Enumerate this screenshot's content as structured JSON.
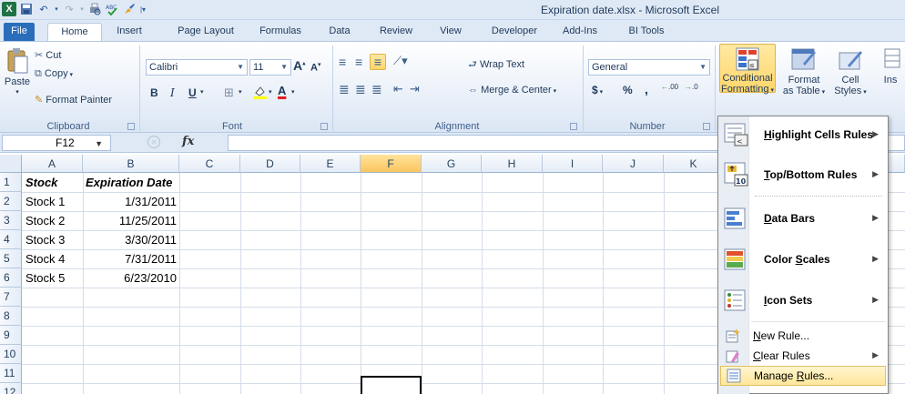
{
  "window": {
    "title": "Expiration date.xlsx - Microsoft Excel"
  },
  "qat": {
    "excel_icon": "X"
  },
  "tabs": [
    {
      "label": "File"
    },
    {
      "label": "Home"
    },
    {
      "label": "Insert"
    },
    {
      "label": "Page Layout"
    },
    {
      "label": "Formulas"
    },
    {
      "label": "Data"
    },
    {
      "label": "Review"
    },
    {
      "label": "View"
    },
    {
      "label": "Developer"
    },
    {
      "label": "Add-Ins"
    },
    {
      "label": "BI Tools"
    }
  ],
  "ribbon": {
    "clipboard": {
      "paste": "Paste",
      "cut": "Cut",
      "copy": "Copy",
      "format_painter": "Format Painter",
      "label": "Clipboard"
    },
    "font": {
      "name": "Calibri",
      "size": "11",
      "bold": "B",
      "italic": "I",
      "underline": "U",
      "label": "Font",
      "grow": "A",
      "shrink": "A",
      "color_a": "A"
    },
    "alignment": {
      "wrap_text": "Wrap Text",
      "merge_center": "Merge & Center",
      "label": "Alignment"
    },
    "number": {
      "format": "General",
      "currency": "$",
      "percent": "%",
      "comma": ",",
      "inc_dec": ".00",
      "dec_dec": ".0",
      "label": "Number"
    },
    "styles": {
      "conditional_1": "Conditional",
      "conditional_2": "Formatting",
      "format_table_1": "Format",
      "format_table_2": "as Table",
      "cell_styles_1": "Cell",
      "cell_styles_2": "Styles",
      "insert": "Ins"
    }
  },
  "formula_bar": {
    "name_box": "F12",
    "fx": "fx",
    "cancel": "×",
    "value": ""
  },
  "columns": [
    "A",
    "B",
    "C",
    "D",
    "E",
    "F",
    "G",
    "H",
    "I",
    "J",
    "K"
  ],
  "rows": [
    "1",
    "2",
    "3",
    "4",
    "5",
    "6",
    "7",
    "8",
    "9",
    "10",
    "11",
    "12"
  ],
  "sheet": {
    "header": {
      "stock": "Stock",
      "expiration": "Expiration Date"
    },
    "data": [
      {
        "stock": "Stock 1",
        "date": "1/31/2011"
      },
      {
        "stock": "Stock 2",
        "date": "11/25/2011"
      },
      {
        "stock": "Stock 3",
        "date": "3/30/2011"
      },
      {
        "stock": "Stock 4",
        "date": "7/31/2011"
      },
      {
        "stock": "Stock 5",
        "date": "6/23/2010"
      }
    ]
  },
  "menu": {
    "highlight": {
      "u": "H",
      "rest": "ighlight Cells Rules"
    },
    "topbottom": {
      "u": "T",
      "rest": "op/Bottom Rules"
    },
    "databars": {
      "u": "D",
      "rest": "ata Bars"
    },
    "colorscales": {
      "pre": "Color ",
      "u": "S",
      "rest": "cales"
    },
    "iconsets": {
      "u": "I",
      "rest": "con Sets"
    },
    "newrule": {
      "u": "N",
      "rest": "ew Rule..."
    },
    "clearrules": {
      "u": "C",
      "rest": "lear Rules"
    },
    "managerules": {
      "pre": "Manage ",
      "u": "R",
      "rest": "ules..."
    }
  },
  "colors": {
    "file_tab": "#2a6ebb",
    "excel_green": "#1f7244",
    "selection": "#ffd66b"
  }
}
